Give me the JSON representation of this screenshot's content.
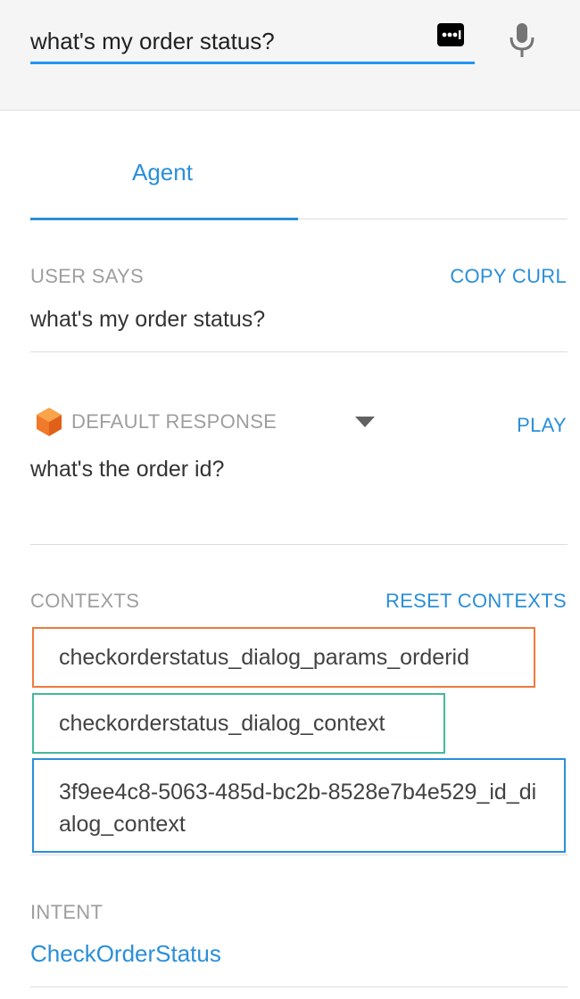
{
  "search": {
    "value": "what's my order status?",
    "dots_icon": "more-options-icon",
    "mic_icon": "microphone-icon"
  },
  "tabs": [
    {
      "label": "Agent"
    }
  ],
  "user_says": {
    "label": "USER SAYS",
    "action": "COPY CURL",
    "text": "what's my order status?"
  },
  "response": {
    "icon": "cube-icon",
    "label": "DEFAULT RESPONSE",
    "action": "PLAY",
    "text": "what's the order id?"
  },
  "contexts": {
    "label": "CONTEXTS",
    "action": "RESET CONTEXTS",
    "items": [
      {
        "name": "checkorderstatus_dialog_params_orderid",
        "color": "#f07a3a"
      },
      {
        "name": "checkorderstatus_dialog_context",
        "color": "#43b99a"
      },
      {
        "name": "3f9ee4c8-5063-485d-bc2b-8528e7b4e529_id_dialog_context",
        "color": "#2a8fd8"
      }
    ]
  },
  "intent": {
    "label": "INTENT",
    "value": "CheckOrderStatus"
  },
  "colors": {
    "accent": "#2a8fd8",
    "input_underline": "#2196f3"
  }
}
